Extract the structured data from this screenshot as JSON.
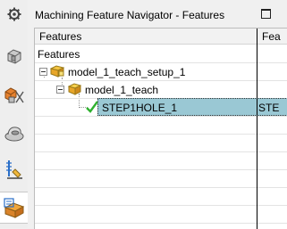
{
  "toolbar": {
    "items": [
      {
        "name": "gear-icon"
      },
      {
        "name": "part-navigator-icon"
      },
      {
        "name": "assembly-navigator-icon"
      },
      {
        "name": "constraint-navigator-icon"
      },
      {
        "name": "machining-tool-navigator-icon"
      },
      {
        "name": "machining-feature-navigator-icon",
        "active": true
      }
    ]
  },
  "panel": {
    "title": "Machining Feature Navigator - Features"
  },
  "table": {
    "columns": [
      "Features",
      "Fea"
    ],
    "group_label": "Features",
    "rows": [
      {
        "label": "model_1_teach_setup_1",
        "second_col": ""
      },
      {
        "label": "model_1_teach",
        "second_col": ""
      },
      {
        "label": "STEP1HOLE_1",
        "second_col": "STE",
        "selected": true
      }
    ]
  },
  "colors": {
    "selection": "#9ac8d4",
    "check": "#2fb12f"
  }
}
